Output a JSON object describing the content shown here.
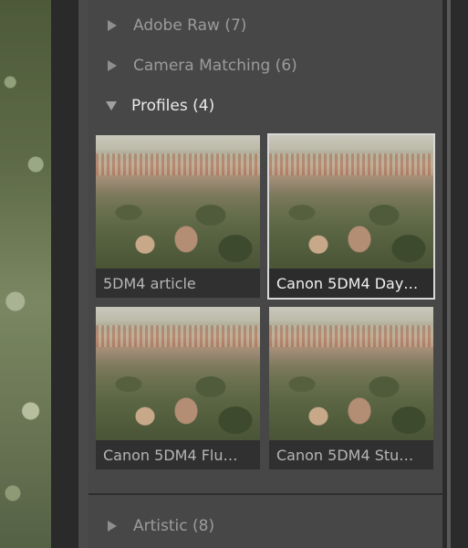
{
  "groups": {
    "adobe_raw": "Adobe Raw (7)",
    "camera_matching": "Camera Matching (6)",
    "profiles": "Profiles (4)",
    "artistic": "Artistic (8)"
  },
  "profiles": [
    {
      "label": "5DM4 article",
      "selected": false
    },
    {
      "label": "Canon 5DM4 Day…",
      "selected": true
    },
    {
      "label": "Canon 5DM4 Flu…",
      "selected": false
    },
    {
      "label": "Canon 5DM4 Stu…",
      "selected": false
    }
  ]
}
